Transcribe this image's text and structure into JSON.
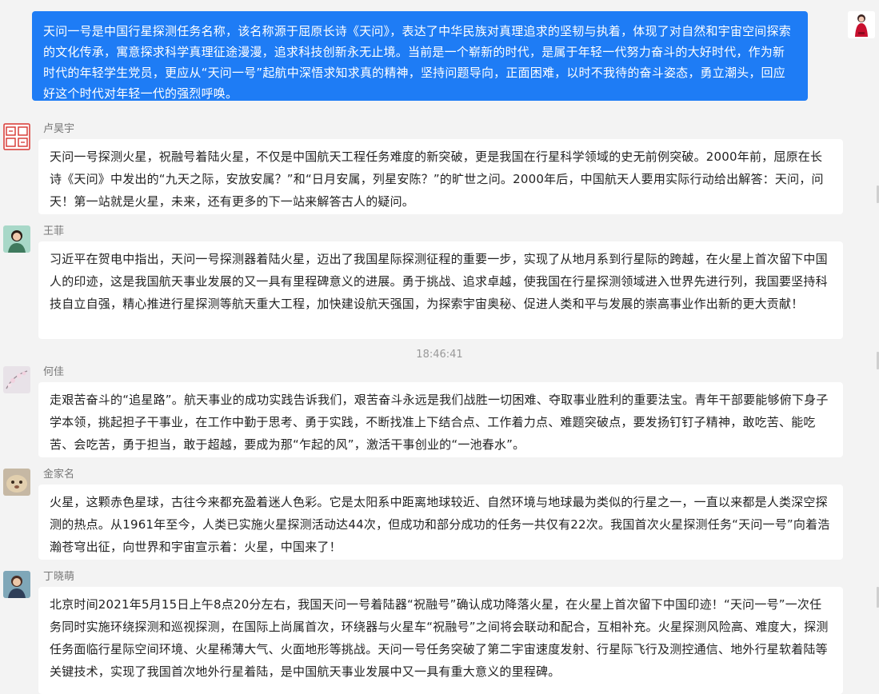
{
  "sent_message": {
    "text": "天问一号是中国行星探测任务名称，该名称源于屈原长诗《天问》，表达了中华民族对真理追求的坚韧与执着，体现了对自然和宇宙空间探索的文化传承，寓意探求科学真理征途漫漫，追求科技创新永无止境。当前是一个崭新的时代，是属于年轻一代努力奋斗的大好时代，作为新时代的年轻学生党员，更应从“天问一号”起航中深悟求知求真的精神，坚持问题导向，正面困难，以时不我待的奋斗姿态，勇立潮头，回应好这个时代对年轻一代的强烈呼唤。"
  },
  "messages": [
    {
      "sender": "卢昊宇",
      "text": "天问一号探测火星，祝融号着陆火星，不仅是中国航天工程任务难度的新突破，更是我国在行星科学领域的史无前例突破。2000年前，屈原在长诗《天问》中发出的“九天之际，安放安属？”和“日月安属，列星安陈？”的旷世之问。2000年后，中国航天人要用实际行动给出解答：天问，问天！第一站就是火星，未来，还有更多的下一站来解答古人的疑问。"
    },
    {
      "sender": "王菲",
      "text": "习近平在贺电中指出，天问一号探测器着陆火星，迈出了我国星际探测征程的重要一步，实现了从地月系到行星际的跨越，在火星上首次留下中国人的印迹，这是我国航天事业发展的又一具有里程碑意义的进展。勇于挑战、追求卓越，使我国在行星探测领域进入世界先进行列，我国要坚持科技自立自强，精心推进行星探测等航天重大工程，加快建设航天强国，为探索宇宙奥秘、促进人类和平与发展的崇高事业作出新的更大贡献！"
    },
    {
      "sender": "何佳",
      "text": "走艰苦奋斗的“追星路”。航天事业的成功实践告诉我们，艰苦奋斗永远是我们战胜一切困难、夺取事业胜利的重要法宝。青年干部要能够俯下身子学本领，挑起担子干事业，在工作中勤于思考、勇于实践，不断找准上下结合点、工作着力点、难题突破点，要发扬钉钉子精神，敢吃苦、能吃苦、会吃苦，勇于担当，敢于超越，要成为那“乍起的风”，激活干事创业的“一池春水”。"
    },
    {
      "sender": "金家名",
      "text": "火星，这颗赤色星球，古往今来都充盈着迷人色彩。它是太阳系中距离地球较近、自然环境与地球最为类似的行星之一，一直以来都是人类深空探测的热点。从1961年至今，人类已实施火星探测活动达44次，但成功和部分成功的任务一共仅有22次。我国首次火星探测任务“天问一号”向着浩瀚苍穹出征，向世界和宇宙宣示着：火星，中国来了！"
    },
    {
      "sender": "丁晓萌",
      "text": "北京时间2021年5月15日上午8点20分左右，我国天问一号着陆器“祝融号”确认成功降落火星，在火星上首次留下中国印迹！“天问一号”一次任务同时实施环绕探测和巡视探测，在国际上尚属首次，环绕器与火星车“祝融号”之间将会联动和配合，互相补充。火星探测风险高、难度大，探测任务面临行星际空间环境、火星稀薄大气、火面地形等挑战。天问一号任务突破了第二宇宙速度发射、行星际飞行及测控通信、地外行星软着陆等关键技术，实现了我国首次地外行星着陆，是中国航天事业发展中又一具有重大意义的里程碑。"
    }
  ],
  "timestamp": "18:46:41",
  "colors": {
    "sent_bubble": "#1e7cf5",
    "received_bubble": "#ffffff",
    "background": "#f3f3f3"
  }
}
